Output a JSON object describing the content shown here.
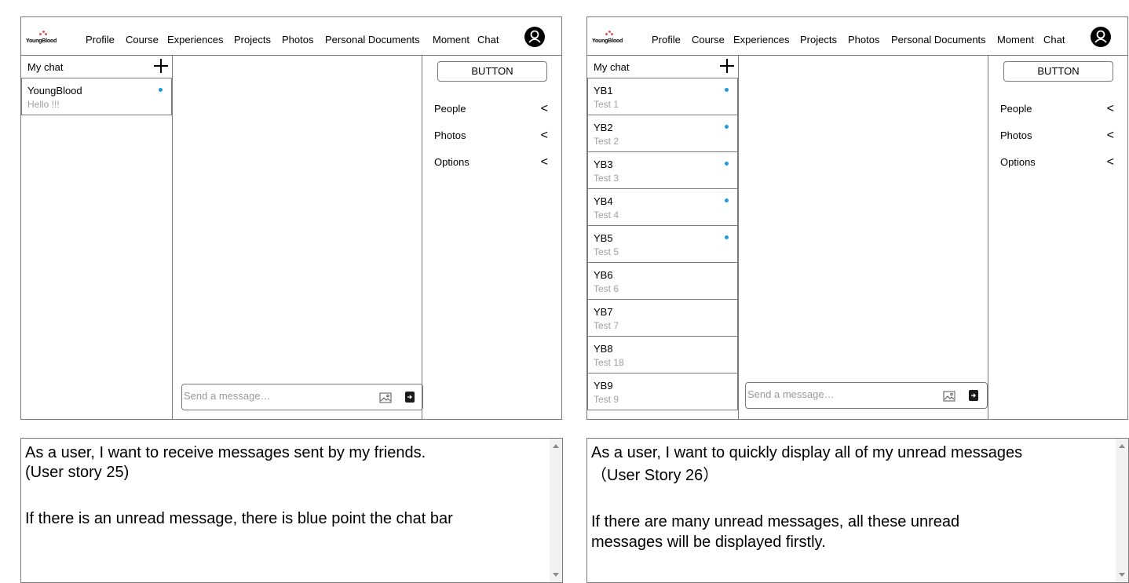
{
  "colors": {
    "unread_dot": "#1a9be0",
    "border": "#7a7a7a",
    "muted_text": "#a0a0a0"
  },
  "nav": {
    "logo_text": "YoungBlood",
    "items": [
      "Profile",
      "Course",
      "Experiences",
      "Projects",
      "Photos",
      "Personal Documents",
      "Moment",
      "Chat"
    ],
    "avatar_icon": "user-avatar-icon"
  },
  "left_mock": {
    "sidebar_title": "My chat",
    "chats": [
      {
        "name": "YoungBlood",
        "preview": "Hello !!!",
        "unread": true
      }
    ],
    "message_placeholder": "Send a message…",
    "button_label": "BUTTON",
    "options": [
      "People",
      "Photos",
      "Options"
    ]
  },
  "right_mock": {
    "sidebar_title": "My chat",
    "chats": [
      {
        "name": "YB1",
        "preview": "Test 1",
        "unread": true
      },
      {
        "name": "YB2",
        "preview": "Test 2",
        "unread": true
      },
      {
        "name": "YB3",
        "preview": "Test 3",
        "unread": true
      },
      {
        "name": "YB4",
        "preview": "Test 4",
        "unread": true
      },
      {
        "name": "YB5",
        "preview": "Test 5",
        "unread": true
      },
      {
        "name": "YB6",
        "preview": "Test 6",
        "unread": false
      },
      {
        "name": "YB7",
        "preview": "Test 7",
        "unread": false
      },
      {
        "name": "YB8",
        "preview": "Test 18",
        "unread": false
      },
      {
        "name": "YB9",
        "preview": "Test 9",
        "unread": false
      }
    ],
    "message_placeholder": "Send a message…",
    "button_label": "BUTTON",
    "options": [
      "People",
      "Photos",
      "Options"
    ]
  },
  "stories": {
    "left": {
      "line1": "As a user, I want to receive messages sent by my friends.",
      "line2": "(User story 25)",
      "line3": "If there is an unread message, there is blue point the chat bar"
    },
    "right": {
      "line1": "As a user, I want to quickly display all of my unread messages",
      "line2": "（User Story 26）",
      "line3": "If there are many unread messages, all these unread",
      "line4": "messages will be displayed firstly."
    }
  }
}
